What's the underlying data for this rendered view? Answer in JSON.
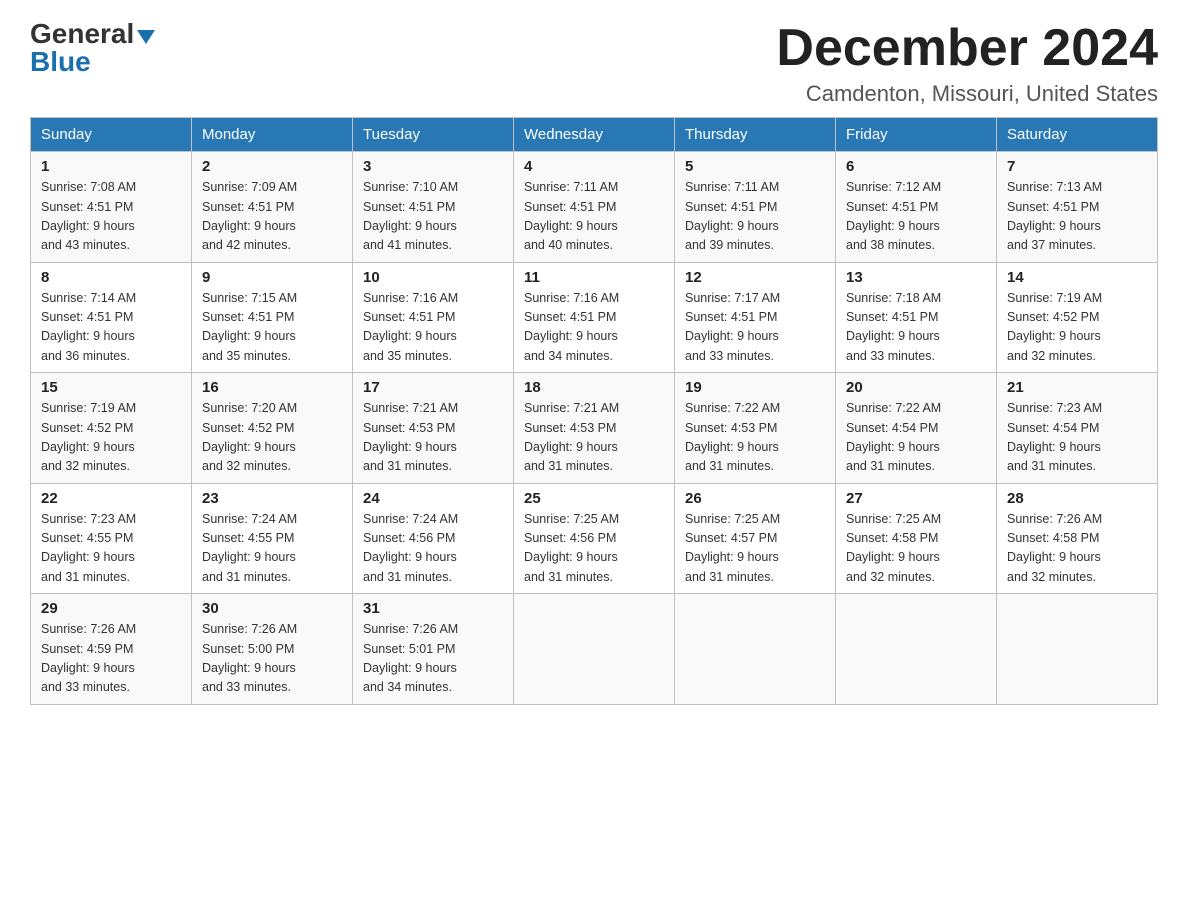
{
  "logo": {
    "general": "General",
    "blue": "Blue"
  },
  "title": "December 2024",
  "location": "Camdenton, Missouri, United States",
  "days_of_week": [
    "Sunday",
    "Monday",
    "Tuesday",
    "Wednesday",
    "Thursday",
    "Friday",
    "Saturday"
  ],
  "weeks": [
    [
      {
        "day": "1",
        "sunrise": "Sunrise: 7:08 AM",
        "sunset": "Sunset: 4:51 PM",
        "daylight": "Daylight: 9 hours",
        "daylight2": "and 43 minutes."
      },
      {
        "day": "2",
        "sunrise": "Sunrise: 7:09 AM",
        "sunset": "Sunset: 4:51 PM",
        "daylight": "Daylight: 9 hours",
        "daylight2": "and 42 minutes."
      },
      {
        "day": "3",
        "sunrise": "Sunrise: 7:10 AM",
        "sunset": "Sunset: 4:51 PM",
        "daylight": "Daylight: 9 hours",
        "daylight2": "and 41 minutes."
      },
      {
        "day": "4",
        "sunrise": "Sunrise: 7:11 AM",
        "sunset": "Sunset: 4:51 PM",
        "daylight": "Daylight: 9 hours",
        "daylight2": "and 40 minutes."
      },
      {
        "day": "5",
        "sunrise": "Sunrise: 7:11 AM",
        "sunset": "Sunset: 4:51 PM",
        "daylight": "Daylight: 9 hours",
        "daylight2": "and 39 minutes."
      },
      {
        "day": "6",
        "sunrise": "Sunrise: 7:12 AM",
        "sunset": "Sunset: 4:51 PM",
        "daylight": "Daylight: 9 hours",
        "daylight2": "and 38 minutes."
      },
      {
        "day": "7",
        "sunrise": "Sunrise: 7:13 AM",
        "sunset": "Sunset: 4:51 PM",
        "daylight": "Daylight: 9 hours",
        "daylight2": "and 37 minutes."
      }
    ],
    [
      {
        "day": "8",
        "sunrise": "Sunrise: 7:14 AM",
        "sunset": "Sunset: 4:51 PM",
        "daylight": "Daylight: 9 hours",
        "daylight2": "and 36 minutes."
      },
      {
        "day": "9",
        "sunrise": "Sunrise: 7:15 AM",
        "sunset": "Sunset: 4:51 PM",
        "daylight": "Daylight: 9 hours",
        "daylight2": "and 35 minutes."
      },
      {
        "day": "10",
        "sunrise": "Sunrise: 7:16 AM",
        "sunset": "Sunset: 4:51 PM",
        "daylight": "Daylight: 9 hours",
        "daylight2": "and 35 minutes."
      },
      {
        "day": "11",
        "sunrise": "Sunrise: 7:16 AM",
        "sunset": "Sunset: 4:51 PM",
        "daylight": "Daylight: 9 hours",
        "daylight2": "and 34 minutes."
      },
      {
        "day": "12",
        "sunrise": "Sunrise: 7:17 AM",
        "sunset": "Sunset: 4:51 PM",
        "daylight": "Daylight: 9 hours",
        "daylight2": "and 33 minutes."
      },
      {
        "day": "13",
        "sunrise": "Sunrise: 7:18 AM",
        "sunset": "Sunset: 4:51 PM",
        "daylight": "Daylight: 9 hours",
        "daylight2": "and 33 minutes."
      },
      {
        "day": "14",
        "sunrise": "Sunrise: 7:19 AM",
        "sunset": "Sunset: 4:52 PM",
        "daylight": "Daylight: 9 hours",
        "daylight2": "and 32 minutes."
      }
    ],
    [
      {
        "day": "15",
        "sunrise": "Sunrise: 7:19 AM",
        "sunset": "Sunset: 4:52 PM",
        "daylight": "Daylight: 9 hours",
        "daylight2": "and 32 minutes."
      },
      {
        "day": "16",
        "sunrise": "Sunrise: 7:20 AM",
        "sunset": "Sunset: 4:52 PM",
        "daylight": "Daylight: 9 hours",
        "daylight2": "and 32 minutes."
      },
      {
        "day": "17",
        "sunrise": "Sunrise: 7:21 AM",
        "sunset": "Sunset: 4:53 PM",
        "daylight": "Daylight: 9 hours",
        "daylight2": "and 31 minutes."
      },
      {
        "day": "18",
        "sunrise": "Sunrise: 7:21 AM",
        "sunset": "Sunset: 4:53 PM",
        "daylight": "Daylight: 9 hours",
        "daylight2": "and 31 minutes."
      },
      {
        "day": "19",
        "sunrise": "Sunrise: 7:22 AM",
        "sunset": "Sunset: 4:53 PM",
        "daylight": "Daylight: 9 hours",
        "daylight2": "and 31 minutes."
      },
      {
        "day": "20",
        "sunrise": "Sunrise: 7:22 AM",
        "sunset": "Sunset: 4:54 PM",
        "daylight": "Daylight: 9 hours",
        "daylight2": "and 31 minutes."
      },
      {
        "day": "21",
        "sunrise": "Sunrise: 7:23 AM",
        "sunset": "Sunset: 4:54 PM",
        "daylight": "Daylight: 9 hours",
        "daylight2": "and 31 minutes."
      }
    ],
    [
      {
        "day": "22",
        "sunrise": "Sunrise: 7:23 AM",
        "sunset": "Sunset: 4:55 PM",
        "daylight": "Daylight: 9 hours",
        "daylight2": "and 31 minutes."
      },
      {
        "day": "23",
        "sunrise": "Sunrise: 7:24 AM",
        "sunset": "Sunset: 4:55 PM",
        "daylight": "Daylight: 9 hours",
        "daylight2": "and 31 minutes."
      },
      {
        "day": "24",
        "sunrise": "Sunrise: 7:24 AM",
        "sunset": "Sunset: 4:56 PM",
        "daylight": "Daylight: 9 hours",
        "daylight2": "and 31 minutes."
      },
      {
        "day": "25",
        "sunrise": "Sunrise: 7:25 AM",
        "sunset": "Sunset: 4:56 PM",
        "daylight": "Daylight: 9 hours",
        "daylight2": "and 31 minutes."
      },
      {
        "day": "26",
        "sunrise": "Sunrise: 7:25 AM",
        "sunset": "Sunset: 4:57 PM",
        "daylight": "Daylight: 9 hours",
        "daylight2": "and 31 minutes."
      },
      {
        "day": "27",
        "sunrise": "Sunrise: 7:25 AM",
        "sunset": "Sunset: 4:58 PM",
        "daylight": "Daylight: 9 hours",
        "daylight2": "and 32 minutes."
      },
      {
        "day": "28",
        "sunrise": "Sunrise: 7:26 AM",
        "sunset": "Sunset: 4:58 PM",
        "daylight": "Daylight: 9 hours",
        "daylight2": "and 32 minutes."
      }
    ],
    [
      {
        "day": "29",
        "sunrise": "Sunrise: 7:26 AM",
        "sunset": "Sunset: 4:59 PM",
        "daylight": "Daylight: 9 hours",
        "daylight2": "and 33 minutes."
      },
      {
        "day": "30",
        "sunrise": "Sunrise: 7:26 AM",
        "sunset": "Sunset: 5:00 PM",
        "daylight": "Daylight: 9 hours",
        "daylight2": "and 33 minutes."
      },
      {
        "day": "31",
        "sunrise": "Sunrise: 7:26 AM",
        "sunset": "Sunset: 5:01 PM",
        "daylight": "Daylight: 9 hours",
        "daylight2": "and 34 minutes."
      },
      null,
      null,
      null,
      null
    ]
  ]
}
